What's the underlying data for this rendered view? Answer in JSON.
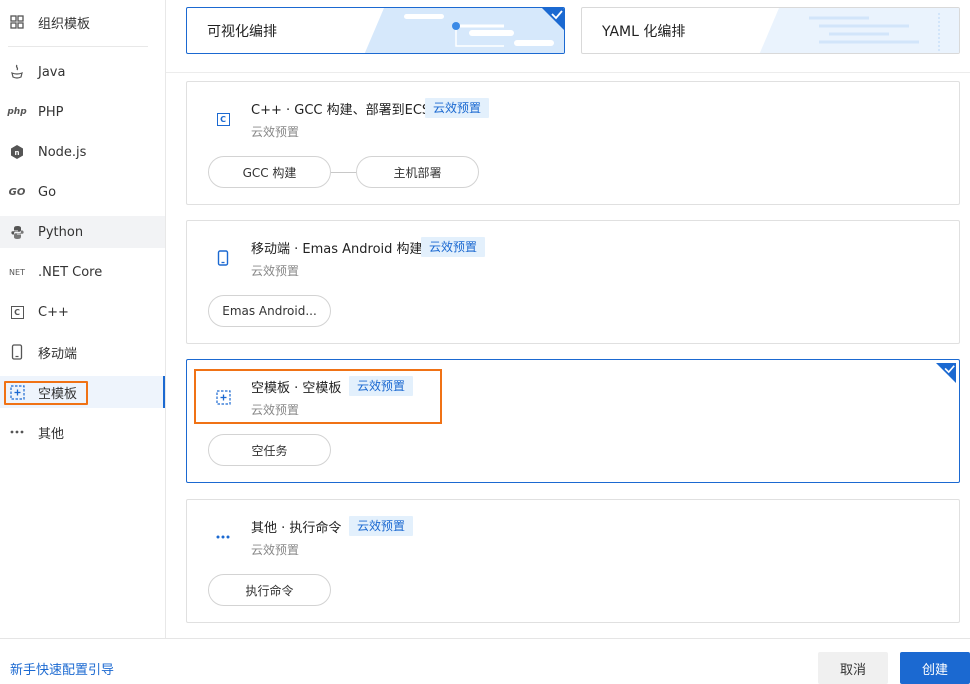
{
  "sidebar": {
    "items": [
      {
        "label": "组织模板",
        "icon": "grid-icon"
      },
      {
        "label": "Java",
        "icon": "java-icon"
      },
      {
        "label": "PHP",
        "icon": "php-icon"
      },
      {
        "label": "Node.js",
        "icon": "nodejs-icon"
      },
      {
        "label": "Go",
        "icon": "go-icon"
      },
      {
        "label": "Python",
        "icon": "python-icon"
      },
      {
        "label": ".NET Core",
        "icon": "dotnet-icon"
      },
      {
        "label": "C++",
        "icon": "cpp-icon"
      },
      {
        "label": "移动端",
        "icon": "mobile-icon"
      },
      {
        "label": "空模板",
        "icon": "empty-template-icon"
      },
      {
        "label": "其他",
        "icon": "more-icon"
      }
    ],
    "php_text": "php",
    "go_text": "GO",
    "net_text": "NET",
    "cpp_text": "C"
  },
  "modes": {
    "visual": "可视化编排",
    "yaml": "YAML 化编排"
  },
  "templates": [
    {
      "title": "C++ · GCC 构建、部署到ECS",
      "badge": "云效预置",
      "subtitle": "云效预置",
      "steps": [
        "GCC 构建",
        "主机部署"
      ],
      "icon_text": "C"
    },
    {
      "title": "移动端 · Emas Android 构建",
      "badge": "云效预置",
      "subtitle": "云效预置",
      "steps": [
        "Emas Android..."
      ]
    },
    {
      "title": "空模板 · 空模板",
      "badge": "云效预置",
      "subtitle": "云效预置",
      "steps": [
        "空任务"
      ]
    },
    {
      "title": "其他 · 执行命令",
      "badge": "云效预置",
      "subtitle": "云效预置",
      "steps": [
        "执行命令"
      ]
    }
  ],
  "footer": {
    "guide": "新手快速配置引导",
    "cancel": "取消",
    "create": "创建"
  },
  "colors": {
    "accent": "#1b69d1",
    "highlight": "#f07215",
    "badge_bg": "#e3f0fc"
  }
}
